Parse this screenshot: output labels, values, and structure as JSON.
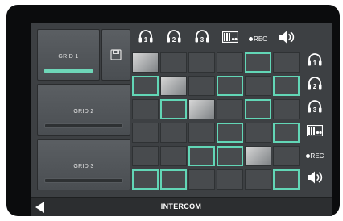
{
  "grids": [
    {
      "label": "GRID 1",
      "active": true
    },
    {
      "label": "GRID 2",
      "active": false
    },
    {
      "label": "GRID 3",
      "active": false
    }
  ],
  "save_icon": "floppy-disk-icon",
  "channels": [
    {
      "icon": "headset-1-icon",
      "number": "1"
    },
    {
      "icon": "headset-2-icon",
      "number": "2"
    },
    {
      "icon": "headset-3-icon",
      "number": "3"
    },
    {
      "icon": "device-panel-icon"
    },
    {
      "icon": "record-icon",
      "text": "REC"
    },
    {
      "icon": "speaker-icon"
    }
  ],
  "matrix": [
    [
      "self",
      "off",
      "off",
      "off",
      "on",
      "off"
    ],
    [
      "on",
      "self",
      "off",
      "on",
      "off",
      "on"
    ],
    [
      "off",
      "on",
      "self",
      "off",
      "on",
      "off"
    ],
    [
      "off",
      "off",
      "off",
      "on",
      "off",
      "on"
    ],
    [
      "off",
      "off",
      "on",
      "on",
      "self",
      "off"
    ],
    [
      "on",
      "on",
      "off",
      "off",
      "off",
      "on"
    ]
  ],
  "accent_color": "#62d6b6",
  "footer": {
    "title": "INTERCOM",
    "back_icon": "back-arrow-icon"
  }
}
